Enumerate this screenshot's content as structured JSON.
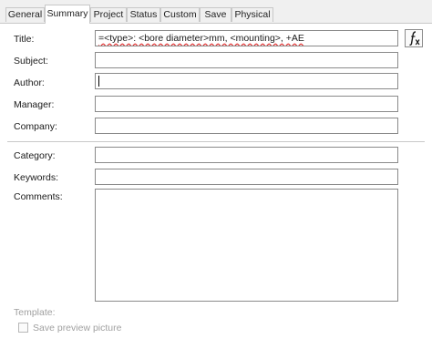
{
  "tabs": [
    {
      "label": "General"
    },
    {
      "label": "Summary"
    },
    {
      "label": "Project"
    },
    {
      "label": "Status"
    },
    {
      "label": "Custom"
    },
    {
      "label": "Save"
    },
    {
      "label": "Physical"
    }
  ],
  "active_tab": "Summary",
  "fields": {
    "title": {
      "label": "Title:",
      "value": "=<type>: <bore diameter>mm, <mounting>, +AE"
    },
    "subject": {
      "label": "Subject:",
      "value": ""
    },
    "author": {
      "label": "Author:",
      "value": ""
    },
    "manager": {
      "label": "Manager:",
      "value": ""
    },
    "company": {
      "label": "Company:",
      "value": ""
    },
    "category": {
      "label": "Category:",
      "value": ""
    },
    "keywords": {
      "label": "Keywords:",
      "value": ""
    },
    "comments": {
      "label": "Comments:",
      "value": ""
    }
  },
  "template": {
    "label": "Template:"
  },
  "save_preview": {
    "label": "Save preview picture",
    "checked": false
  },
  "formula_button": {
    "icon": "function-fx-icon"
  }
}
